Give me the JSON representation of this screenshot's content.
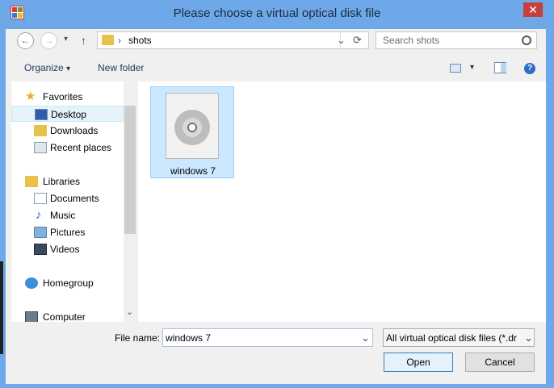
{
  "window": {
    "title": "Please choose a virtual optical disk file",
    "close_glyph": "✕"
  },
  "navigation": {
    "back_glyph": "←",
    "forward_glyph": "→",
    "recent_glyph": "▾",
    "up_glyph": "↑"
  },
  "address": {
    "folder": "shots",
    "separator": "›",
    "refresh_glyph": "⟳"
  },
  "search": {
    "placeholder": "Search shots",
    "icon": "search-icon"
  },
  "toolbar": {
    "organize_label": "Organize",
    "organize_arrow": "▾",
    "new_folder_label": "New folder",
    "view_arrow": "▾",
    "help_glyph": "?"
  },
  "sidebar": {
    "favorites": {
      "label": "Favorites",
      "items": [
        "Desktop",
        "Downloads",
        "Recent places"
      ]
    },
    "libraries": {
      "label": "Libraries",
      "items": [
        "Documents",
        "Music",
        "Pictures",
        "Videos"
      ]
    },
    "homegroup": "Homegroup",
    "computer": "Computer",
    "scroll_down_glyph": "⌄"
  },
  "files": [
    {
      "name": "windows 7",
      "type": "disc-image"
    }
  ],
  "footer": {
    "file_name_label": "File name:",
    "file_name_value": "windows 7",
    "file_type_value": "All virtual optical disk files (*.dr",
    "dropdown_glyph": "⌄",
    "open_label": "Open",
    "cancel_label": "Cancel"
  },
  "colors": {
    "titlebar": "#6fa8e8",
    "close": "#c7403a",
    "selection": "#cce8ff"
  }
}
